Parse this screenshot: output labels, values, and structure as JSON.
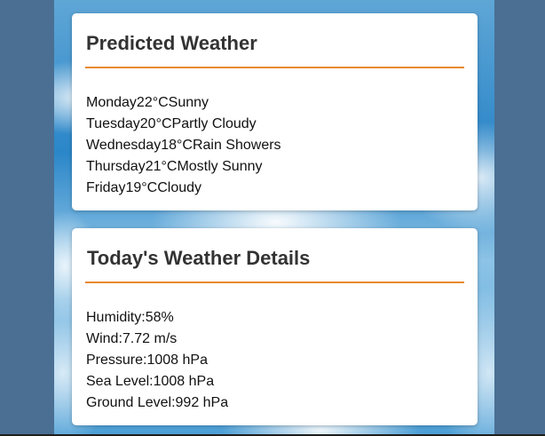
{
  "forecast": {
    "title": "Predicted Weather",
    "days": [
      {
        "day": "Monday",
        "temp": "22°C",
        "condition": "Sunny"
      },
      {
        "day": "Tuesday",
        "temp": "20°C",
        "condition": "Partly Cloudy"
      },
      {
        "day": "Wednesday",
        "temp": "18°C",
        "condition": "Rain Showers"
      },
      {
        "day": "Thursday",
        "temp": "21°C",
        "condition": "Mostly Sunny"
      },
      {
        "day": "Friday",
        "temp": "19°C",
        "condition": "Cloudy"
      }
    ]
  },
  "details": {
    "title": "Today's Weather Details",
    "items": [
      {
        "label": "Humidity:",
        "value": "58%"
      },
      {
        "label": "Wind:",
        "value": "7.72 m/s"
      },
      {
        "label": "Pressure:",
        "value": "1008 hPa"
      },
      {
        "label": "Sea Level:",
        "value": "1008 hPa"
      },
      {
        "label": "Ground Level:",
        "value": "992 hPa"
      }
    ]
  },
  "colors": {
    "page_background": "#4a6f93",
    "accent_rule": "#e8892e",
    "card_background": "#ffffff"
  }
}
